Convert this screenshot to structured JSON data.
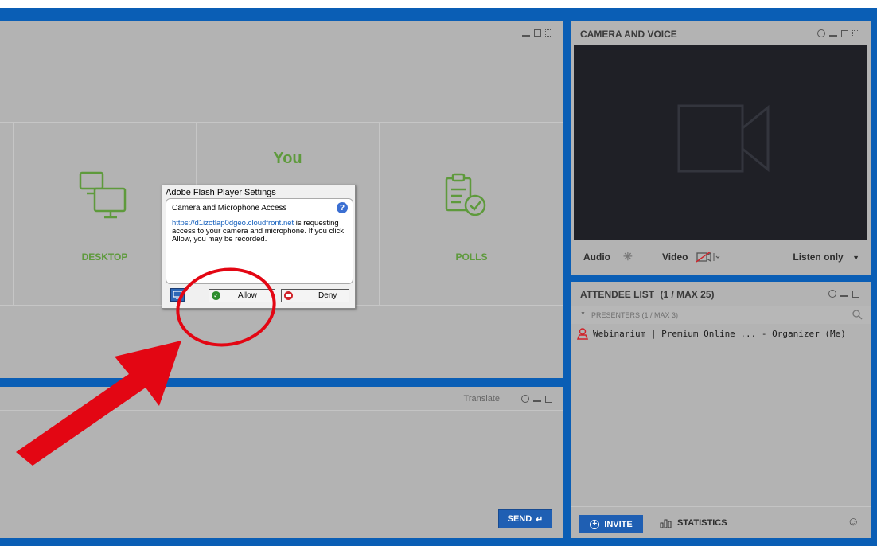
{
  "share_panel": {
    "tiles": [
      {
        "label": "DESKTOP",
        "icon": "desktop-icon"
      },
      {
        "label": "You",
        "icon": "video-icon"
      },
      {
        "label": "POLLS",
        "icon": "polls-icon"
      }
    ]
  },
  "chat_panel": {
    "translate_label": "Translate",
    "send_label": "SEND"
  },
  "camera_panel": {
    "title": "CAMERA AND VOICE",
    "audio_label": "Audio",
    "video_label": "Video",
    "listen_label": "Listen only"
  },
  "attendee_panel": {
    "title": "ATTENDEE LIST",
    "count": "(1 / MAX 25)",
    "presenters_label": "PRESENTERS (1 / MAX 3)",
    "attendees": [
      {
        "name": "Webinarium | Premium Online ... - Organizer (Me)"
      }
    ],
    "invite_label": "INVITE",
    "statistics_label": "STATISTICS"
  },
  "flash_dialog": {
    "title": "Adobe Flash Player Settings",
    "heading": "Camera and Microphone Access",
    "link": "https://d1izotlap0dgeo.cloudfront.net",
    "message": " is requesting access to your camera and microphone. If you click Allow, you may be recorded.",
    "allow_label": "Allow",
    "deny_label": "Deny"
  },
  "colors": {
    "frame": "#0a5eb5",
    "panel": "#b3b3b3",
    "tile_green": "#5e9a3c",
    "button_blue": "#1f5fb3",
    "annotation_red": "#e30613"
  }
}
